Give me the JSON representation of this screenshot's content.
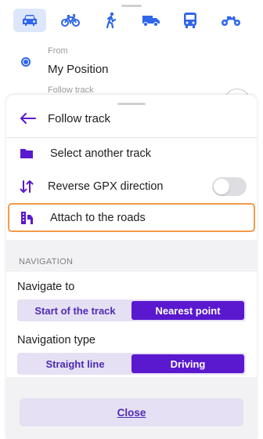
{
  "colors": {
    "accent": "#5a18cf",
    "accent_light": "#e6e0f4",
    "map_blue": "#2f66ea",
    "highlight": "#f29a4a"
  },
  "transport_modes": [
    {
      "icon": "car-icon",
      "active": true
    },
    {
      "icon": "bicycle-icon",
      "active": false
    },
    {
      "icon": "pedestrian-icon",
      "active": false
    },
    {
      "icon": "truck-icon",
      "active": false
    },
    {
      "icon": "bus-icon",
      "active": false
    },
    {
      "icon": "motorcycle-icon",
      "active": false
    }
  ],
  "route": {
    "from_label": "From",
    "from_value": "My Position",
    "follow_label": "Follow track"
  },
  "sheet": {
    "title": "Follow track",
    "back_icon": "arrow-left-icon",
    "items": [
      {
        "label": "Select another track",
        "icon": "folder-icon"
      },
      {
        "label": "Reverse GPX direction",
        "icon": "reverse-arrows-icon",
        "toggle": false
      },
      {
        "label": "Attach to the roads",
        "icon": "attach-roads-icon"
      }
    ],
    "section_title": "NAVIGATION",
    "navigate_to": {
      "label": "Navigate to",
      "options": [
        "Start of the track",
        "Nearest point"
      ],
      "selected": "Nearest point"
    },
    "navigation_type": {
      "label": "Navigation type",
      "options": [
        "Straight line",
        "Driving"
      ],
      "selected": "Driving"
    },
    "close_label": "Close"
  }
}
